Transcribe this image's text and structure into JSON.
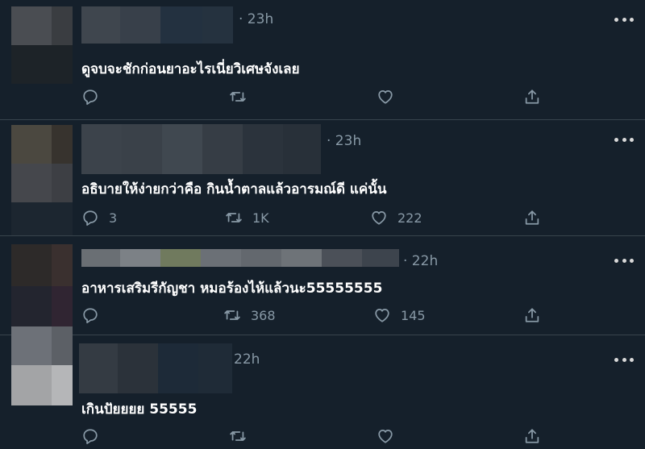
{
  "tweets": [
    {
      "time": "· 23h",
      "text": "ดูจบจะชักก่อนยาอะไรเนี่ยวิเศษจังเลย",
      "replies": "",
      "retweets": "",
      "likes": ""
    },
    {
      "time": "· 23h",
      "text": "อธิบายให้ง่ายกว่าคือ กินน้ำตาลแล้วอารมณ์ดี แค่นั้น",
      "replies": "3",
      "retweets": "1K",
      "likes": "222"
    },
    {
      "time": "· 22h",
      "text": "อาหารเสริมรีกัญชา หมอร้องไห้แล้วนะ55555555",
      "replies": "",
      "retweets": "368",
      "likes": "145"
    },
    {
      "time": "22h",
      "text": "เกินปัยยยย 55555",
      "replies": "",
      "retweets": "",
      "likes": ""
    }
  ],
  "icons": {
    "reply": "reply-icon",
    "retweet": "retweet-icon",
    "like": "heart-icon",
    "share": "share-icon",
    "more": "more-icon"
  },
  "colors": {
    "background": "#15202b",
    "divider": "#38444d",
    "secondary_text": "#8899a6",
    "primary_text": "#ffffff"
  }
}
